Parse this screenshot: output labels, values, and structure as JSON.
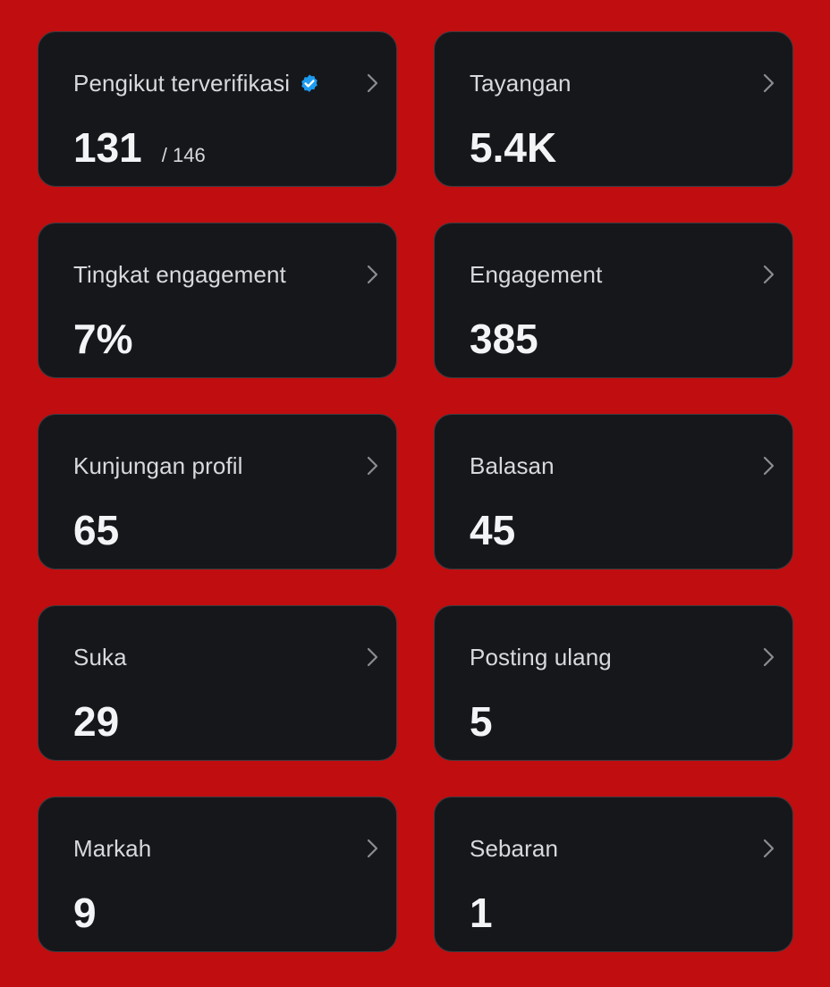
{
  "colors": {
    "background": "#c00d0f",
    "card": "#16171b",
    "verified_badge": "#1d9bf0"
  },
  "cards": [
    {
      "label": "Pengikut terverifikasi",
      "value": "131",
      "sub": "/ 146",
      "icon": "verified-badge-icon"
    },
    {
      "label": "Tayangan",
      "value": "5.4K"
    },
    {
      "label": "Tingkat engagement",
      "value": "7%"
    },
    {
      "label": "Engagement",
      "value": "385"
    },
    {
      "label": "Kunjungan profil",
      "value": "65"
    },
    {
      "label": "Balasan",
      "value": "45"
    },
    {
      "label": "Suka",
      "value": "29"
    },
    {
      "label": "Posting ulang",
      "value": "5"
    },
    {
      "label": "Markah",
      "value": "9"
    },
    {
      "label": "Sebaran",
      "value": "1"
    }
  ]
}
